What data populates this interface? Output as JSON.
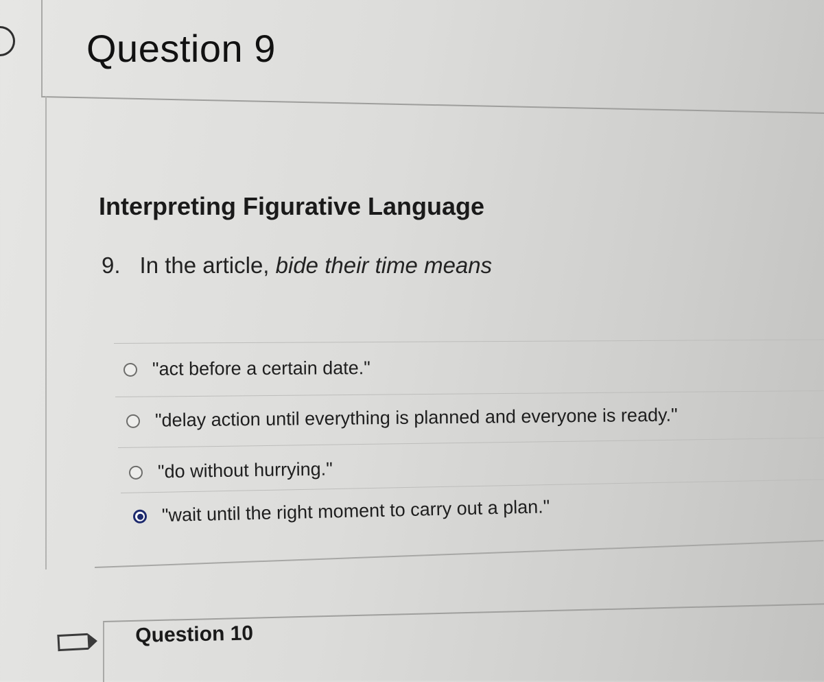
{
  "question9": {
    "title": "Question 9",
    "section_title": "Interpreting Figurative Language",
    "question_number": "9.",
    "question_prefix": "In the article, ",
    "question_emphasis": "bide their time means",
    "answers": [
      {
        "label": "\"act before a certain date.\"",
        "selected": false
      },
      {
        "label": "\"delay action until everything is planned and everyone is ready.\"",
        "selected": false
      },
      {
        "label": "\"do without hurrying.\"",
        "selected": false
      },
      {
        "label": "\"wait until the right moment to carry out a plan.\"",
        "selected": true
      }
    ]
  },
  "question10": {
    "title": "Question 10"
  },
  "colors": {
    "selected_radio": "#1d2a6e"
  },
  "icons": {
    "question9_flag": "flag-icon",
    "question10_flag": "flag-icon"
  }
}
